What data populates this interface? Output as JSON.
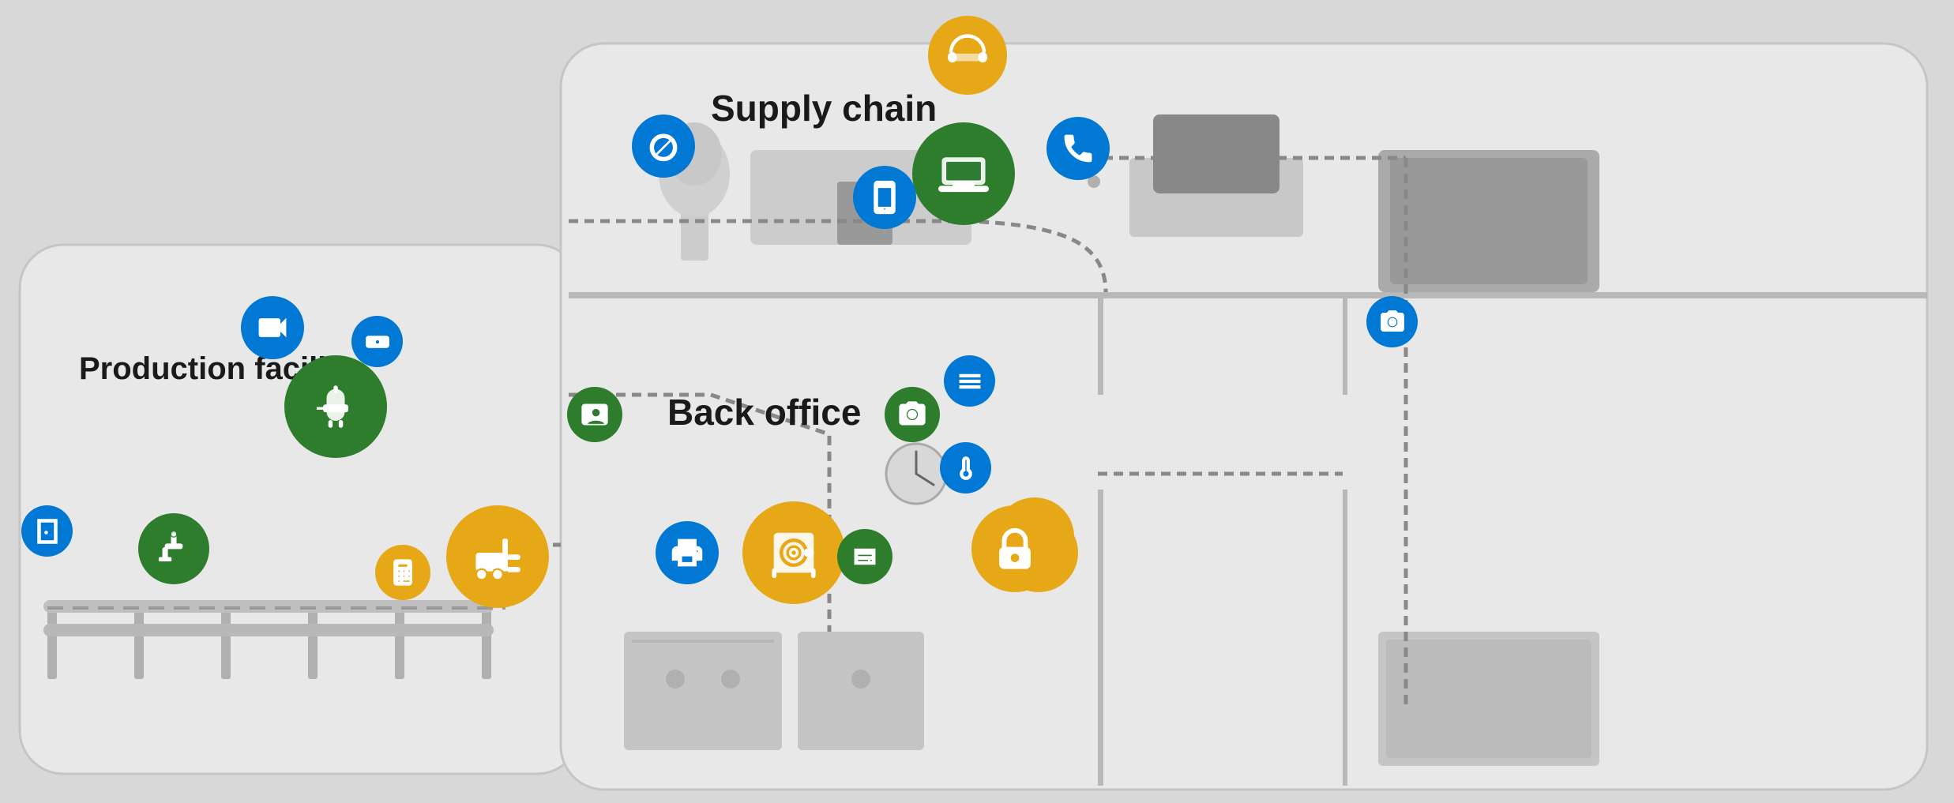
{
  "labels": {
    "production_facility": "Production facility",
    "back_office": "Back office",
    "supply_chain": "Supply chain"
  },
  "colors": {
    "green": "#2e7d32",
    "blue": "#0078d4",
    "yellow": "#e6a817",
    "building_bg": "#e8e8e8",
    "building_border": "#c0c0c0",
    "bg": "#d4d4d4"
  },
  "icons": {
    "robot_arm": "🦾",
    "tank": "🏭",
    "forklift": "🚜",
    "conveyor": "⚙️",
    "camera": "📷",
    "laptop": "💻",
    "phone": "📱",
    "printer": "🖨️",
    "safe": "🔐",
    "lock": "🔒",
    "keypad": "⌨️",
    "sensor": "📡",
    "thermostat": "🌡️",
    "badge": "🪪",
    "calculator": "🔢"
  }
}
